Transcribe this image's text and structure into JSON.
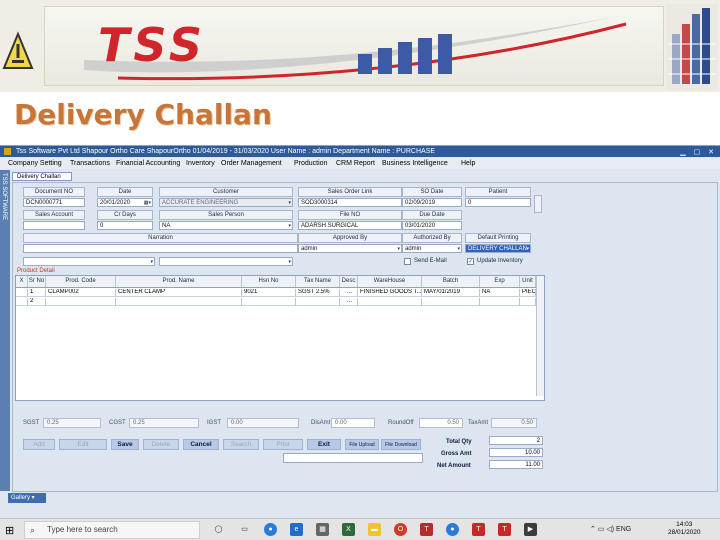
{
  "banner": {
    "logo": "TSS",
    "page_title": "Delivery Challan"
  },
  "window": {
    "title": "Tss Software Pvt Ltd  Shapour Ortho Care  ShapourOrtho   01/04/2019 - 31/03/2020  User Name : admin  Department Name : PURCHASE",
    "sidebar_label": "TSS SOFTWARE",
    "tab": "Delivery Challan"
  },
  "menu": [
    "Company Setting",
    "Transactions",
    "Financial Accounting",
    "Inventory",
    "Order Management",
    "Production",
    "CRM Report",
    "Business Intelligence",
    "Help"
  ],
  "form": {
    "document_no": {
      "label": "Document NO",
      "value": "DCN0000771"
    },
    "date": {
      "label": "Date",
      "value": "20/01/2020"
    },
    "customer": {
      "label": "Customer",
      "value": "ACCURATE ENGINEERING"
    },
    "sales_order_link": {
      "label": "Sales Order Link",
      "value": "SOD3000314"
    },
    "so_date": {
      "label": "SO Date",
      "value": "02/09/2019"
    },
    "patient": {
      "label": "Patient",
      "value": "0"
    },
    "sales_account": {
      "label": "Sales Account",
      "value": ""
    },
    "cr_days": {
      "label": "Cr Days",
      "value": "0"
    },
    "sales_person": {
      "label": "Sales Person",
      "value": "NA"
    },
    "file_no": {
      "label": "File NO",
      "value": "ADARSH SURGICAL"
    },
    "due_date": {
      "label": "Due Date",
      "value": "03/01/2020"
    },
    "narration": {
      "label": "Narration",
      "value": ""
    },
    "approved_by": {
      "label": "Approved By",
      "value": "admin"
    },
    "authorized_by": {
      "label": "Authorized By",
      "value": "admin"
    },
    "default_printing": {
      "label": "Default Printing",
      "value": "DELIVERY CHALLAN"
    },
    "send_email": "Send E-Mail",
    "update_inventory": "Update Inventory",
    "product_detail": "Product Detail"
  },
  "grid": {
    "columns": [
      "X",
      "Sr No",
      "Prod. Code",
      "Prod. Name",
      "Hsn No",
      "Tax Name",
      "Desc",
      "WareHouse",
      "Batch",
      "Exp",
      "Unit"
    ],
    "rows": [
      [
        "",
        "1",
        "CLAMP002",
        "CENTER CLAMP",
        "9021",
        "SGST 2.5%",
        "...",
        "FINISHED GOODS T...",
        "MAY/01/2019",
        "NA",
        "PIECES"
      ],
      [
        "",
        "2",
        "",
        "",
        "",
        "",
        "...",
        "",
        "",
        "",
        ""
      ]
    ]
  },
  "totals": {
    "sgst": {
      "label": "SGST",
      "value": "0.25"
    },
    "cgst": {
      "label": "CGST",
      "value": "0.25"
    },
    "igst": {
      "label": "IGST",
      "value": "0.00"
    },
    "disamt": {
      "label": "DisAmt",
      "value": "0.00"
    },
    "roundoff": {
      "label": "RoundOff",
      "value": "0.50"
    },
    "taxamt": {
      "label": "TaxAmt",
      "value": "0.50"
    }
  },
  "buttons": [
    "Add",
    "Edit",
    "Save",
    "Delete",
    "Cancel",
    "Search",
    "Print",
    "Exit",
    "File Upload",
    "File Download"
  ],
  "summary": {
    "total_qty": {
      "label": "Total Qty",
      "value": "2"
    },
    "gross_amt": {
      "label": "Gross Amt",
      "value": "10.00"
    },
    "net_amount": {
      "label": "Net Amount",
      "value": "11.00"
    }
  },
  "gallery": "Gallery",
  "taskbar": {
    "search_placeholder": "Type here to search",
    "lang": "ENG",
    "time": "14:03",
    "date": "28/01/2020"
  }
}
